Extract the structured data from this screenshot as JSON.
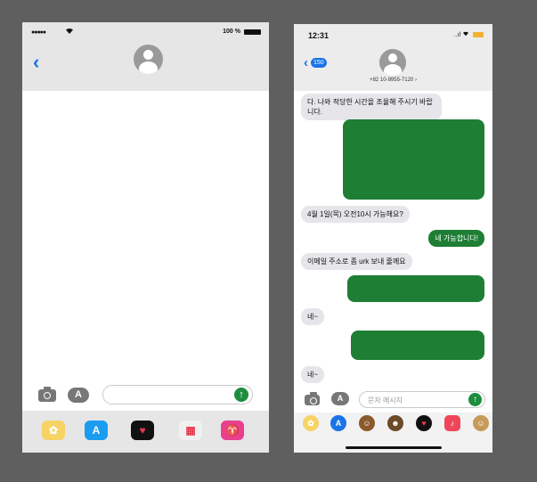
{
  "phone1": {
    "status": {
      "signal": "●●●●●",
      "wifi": "wifi-icon",
      "battery_text": "100 %"
    },
    "header": {
      "back": "‹"
    },
    "input": {
      "placeholder": "",
      "send": "↑"
    },
    "tray": [
      {
        "name": "photos-app",
        "glyph": "✿",
        "color": "#f5a623"
      },
      {
        "name": "app-store",
        "glyph": "A",
        "color": "#1a9cf0"
      },
      {
        "name": "digital-touch",
        "glyph": "♥",
        "color": "#111111"
      },
      {
        "name": "calendar-app",
        "glyph": "▦",
        "color": "#f0f0f0"
      },
      {
        "name": "hanger-app",
        "glyph": "♈",
        "color": "#e8408d"
      }
    ]
  },
  "phone2": {
    "status": {
      "time": "12:31",
      "signal": "..ıl"
    },
    "header": {
      "back": "‹",
      "badge": "150",
      "number": "+82 10-9955-7120 ›"
    },
    "messages": {
      "m1": "다. 나와 적당한 시간을 조율해 주시기 바랍니다.",
      "m2": "4월 1일(목) 오전10시 가능해요?",
      "m3": "네 가능합니다!",
      "m4": "이메일 주소로 좀 urk  보내 줄께요",
      "m5": "네~",
      "m6": "네~"
    },
    "input": {
      "placeholder": "문자 메시지",
      "send": "↑"
    },
    "tray": [
      {
        "name": "photos-app",
        "glyph": "✿",
        "color": "#f5a623"
      },
      {
        "name": "app-store",
        "glyph": "A",
        "color": "#1a73e8"
      },
      {
        "name": "memoji-1",
        "glyph": "☺",
        "color": "#8a5a2b"
      },
      {
        "name": "memoji-2",
        "glyph": "☻",
        "color": "#6b4a2a"
      },
      {
        "name": "digital-touch",
        "glyph": "♥",
        "color": "#111111"
      },
      {
        "name": "music-app",
        "glyph": "♪",
        "color": "#f0465a"
      },
      {
        "name": "memoji-3",
        "glyph": "☺",
        "color": "#c79a5a"
      }
    ]
  },
  "colors": {
    "accent": "#1a73e8",
    "outgoing": "#1e7e34",
    "incoming": "#e5e5ea",
    "background": "#5f5f5f"
  }
}
